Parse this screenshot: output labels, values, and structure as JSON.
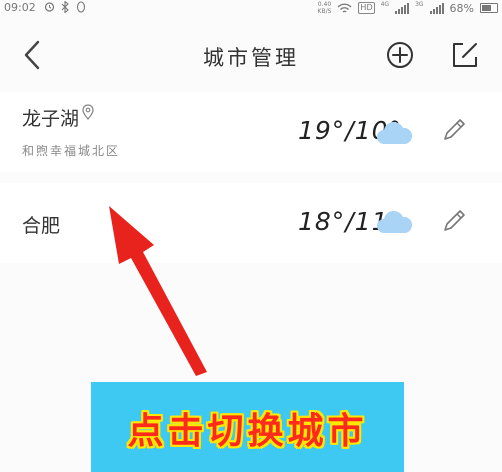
{
  "status_bar": {
    "time": "09:02",
    "net_speed_value": "0.40",
    "net_speed_unit": "KB/S",
    "hd": "HD",
    "net1": "4G",
    "net2": "3G",
    "battery": "68%"
  },
  "header": {
    "title": "城市管理"
  },
  "cities": [
    {
      "name": "龙子湖",
      "subtitle": "和煦幸福城北区",
      "temp": "19°/10°"
    },
    {
      "name": "合肥",
      "subtitle": "",
      "temp": "18°/11°"
    }
  ],
  "banner": {
    "text": "点击切换城市"
  },
  "colors": {
    "arrow": "#e8221c",
    "banner_bg": "#3ec9f2",
    "banner_text": "#ff2a1e",
    "banner_outline": "#ffe800",
    "cloud": "#a9d4f5"
  }
}
